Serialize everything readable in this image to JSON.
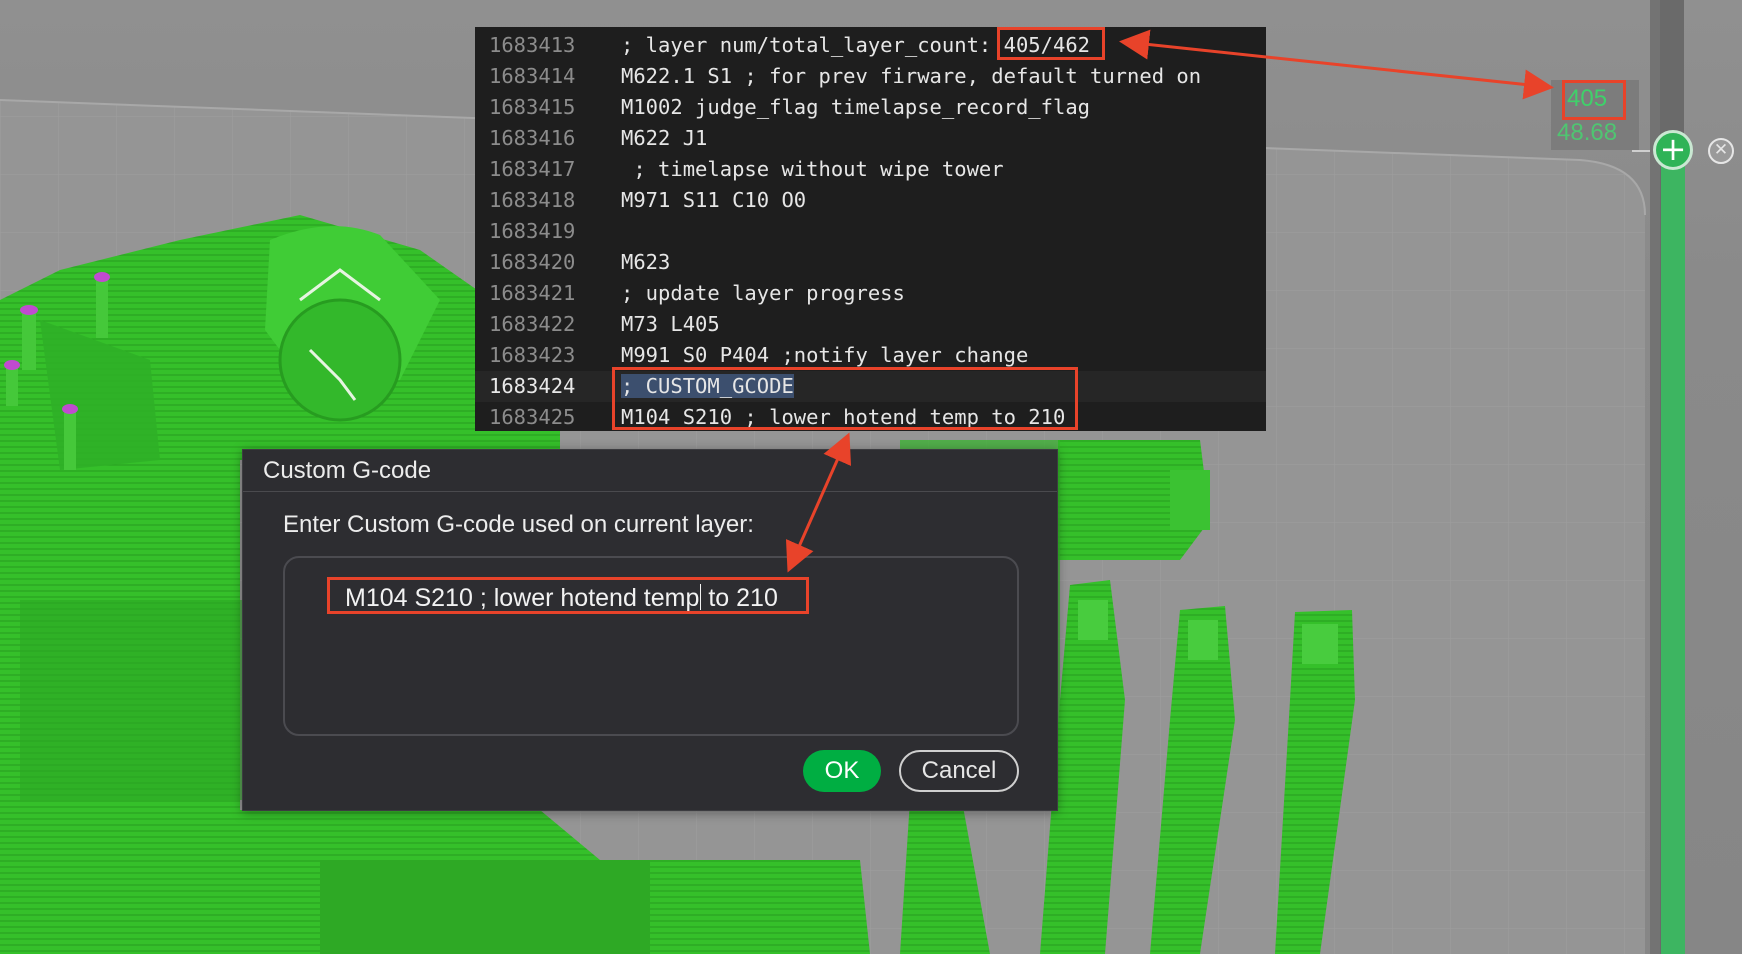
{
  "code_viewer": {
    "lines": [
      {
        "num": "1683413",
        "text": "; layer num/total_layer_count: ",
        "highlight": "405/462"
      },
      {
        "num": "1683414",
        "text": "M622.1 S1 ; for prev firware, default turned on"
      },
      {
        "num": "1683415",
        "text": "M1002 judge_flag timelapse_record_flag"
      },
      {
        "num": "1683416",
        "text": "M622 J1"
      },
      {
        "num": "1683417",
        "text": " ; timelapse without wipe tower"
      },
      {
        "num": "1683418",
        "text": "M971 S11 C10 O0"
      },
      {
        "num": "1683419",
        "text": ""
      },
      {
        "num": "1683420",
        "text": "M623"
      },
      {
        "num": "1683421",
        "text": "; update layer progress"
      },
      {
        "num": "1683422",
        "text": "M73 L405"
      },
      {
        "num": "1683423",
        "text": "M991 S0 P404 ;notify layer change"
      },
      {
        "num": "1683424",
        "text": "; CUSTOM_GCODE",
        "current": true
      },
      {
        "num": "1683425",
        "text": "M104 S210 ; lower hotend temp to 210"
      }
    ]
  },
  "dialog": {
    "title": "Custom G-code",
    "prompt": "Enter Custom G-code used on current layer:",
    "input_value_before_caret": "M104 S210 ; lower hotend temp",
    "input_value_after_caret": " to 210",
    "ok_label": "OK",
    "cancel_label": "Cancel"
  },
  "layer_slider": {
    "current_layer": "405",
    "layer_height": "48.68",
    "handle_icon": "plus-icon",
    "close_icon": "close-icon"
  },
  "colors": {
    "accent_green": "#00ae42",
    "model_green": "#3ec23c",
    "annotation_red": "#e8432a",
    "code_bg": "#1e1e1e",
    "dialog_bg": "#2d2d31"
  }
}
